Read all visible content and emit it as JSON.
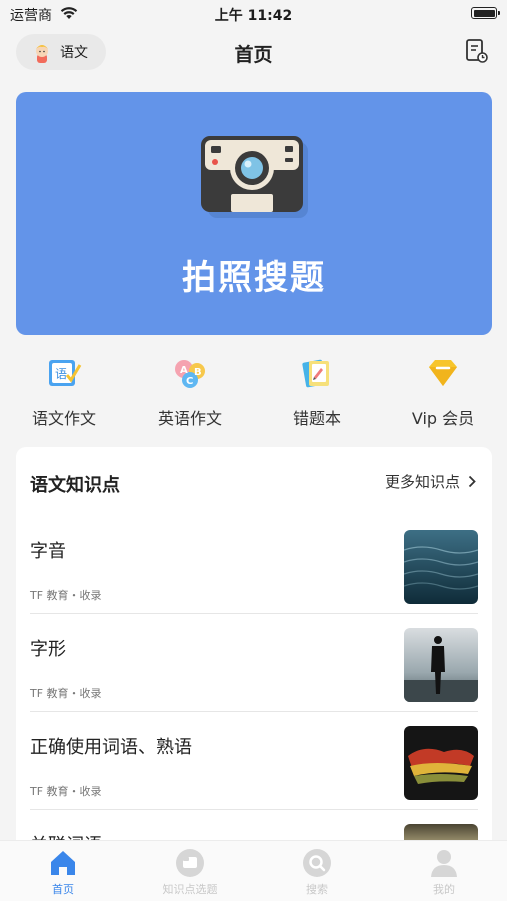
{
  "status_bar": {
    "carrier": "运营商",
    "time": "上午 11:42"
  },
  "nav": {
    "subject": "语文",
    "title": "首页",
    "record_icon": "record-icon"
  },
  "hero": {
    "label": "拍照搜题",
    "icon": "camera-icon"
  },
  "shortcuts": [
    {
      "label": "语文作文",
      "icon": "chinese-essay-icon"
    },
    {
      "label": "英语作文",
      "icon": "english-essay-icon"
    },
    {
      "label": "错题本",
      "icon": "notebook-icon"
    },
    {
      "label": "Vip 会员",
      "icon": "vip-diamond-icon"
    }
  ],
  "knowledge": {
    "title": "语文知识点",
    "more": "更多知识点",
    "items": [
      {
        "title": "字音",
        "meta": "TF 教育・收录"
      },
      {
        "title": "字形",
        "meta": "TF 教育・收录"
      },
      {
        "title": "正确使用词语、熟语",
        "meta": "TF 教育・收录"
      },
      {
        "title": "关联词语",
        "meta": ""
      }
    ]
  },
  "tabs": [
    {
      "label": "首页",
      "icon": "home-icon",
      "active": true
    },
    {
      "label": "知识点选题",
      "icon": "knowledge-icon",
      "active": false
    },
    {
      "label": "搜索",
      "icon": "search-icon",
      "active": false
    },
    {
      "label": "我的",
      "icon": "profile-icon",
      "active": false
    }
  ],
  "colors": {
    "accent": "#3a86ea",
    "hero": "#6394e9",
    "vip": "#f7c52b"
  }
}
